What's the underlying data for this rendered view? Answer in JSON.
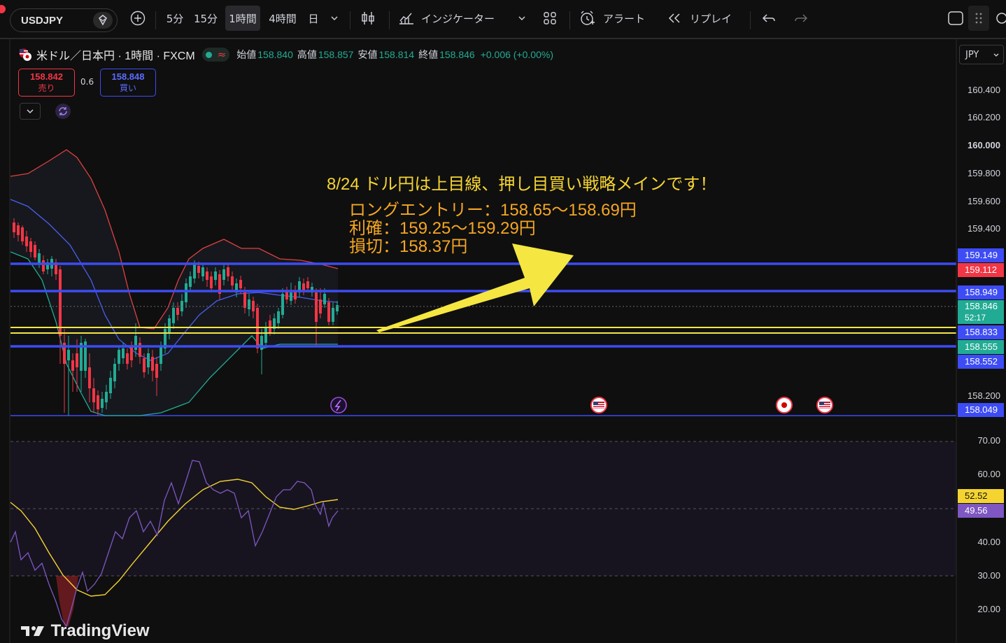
{
  "toolbar": {
    "symbol": "USDJPY",
    "intervals": [
      "5分",
      "15分",
      "1時間",
      "4時間",
      "日"
    ],
    "indicators_label": "インジケーター",
    "alert_label": "アラート",
    "replay_label": "リプレイ"
  },
  "legend": {
    "title": "米ドル／日本円 · 1時間 · FXCM",
    "open_label": "始値",
    "open": "158.840",
    "high_label": "高値",
    "high": "158.857",
    "low_label": "安値",
    "low": "158.814",
    "close_label": "終値",
    "close": "158.846",
    "change": "+0.006 (+0.00%)"
  },
  "trade": {
    "sell_price": "158.842",
    "sell_label": "売り",
    "spread": "0.6",
    "buy_price": "158.848",
    "buy_label": "買い"
  },
  "currency": "JPY",
  "price_axis": [
    "160.400",
    "160.200",
    "160.000",
    "159.800",
    "159.600",
    "159.400",
    "158.200"
  ],
  "price_tags": [
    {
      "value": "159.149",
      "color": "#3d4cf5"
    },
    {
      "value": "159.112",
      "color": "#f23645"
    },
    {
      "value": "158.949",
      "color": "#3d4cf5"
    },
    {
      "value": "158.846",
      "color": "#22ab94",
      "countdown": "52:17"
    },
    {
      "value": "158.833",
      "color": "#3d4cf5"
    },
    {
      "value": "158.555",
      "color": "#22ab94"
    },
    {
      "value": "158.552",
      "color": "#3d4cf5"
    },
    {
      "value": "158.049",
      "color": "#3d4cf5"
    }
  ],
  "rsi_axis": [
    "70.00",
    "60.00",
    "40.00",
    "30.00",
    "20.00"
  ],
  "rsi_tags": [
    {
      "value": "52.52",
      "color": "#f5d432"
    },
    {
      "value": "49.56",
      "color": "#7e57c2"
    }
  ],
  "annotation": {
    "headline": "8/24 ドル円は上目線、押し目買い戦略メインです！",
    "entry": "ロングエントリー：158.65〜158.69円",
    "take_profit": "利確：159.25〜159.29円",
    "stop_loss": "損切：158.37円"
  },
  "brand": "TradingView",
  "colors": {
    "background": "#0f0f0f",
    "up": "#22ab94",
    "down": "#f23645",
    "level_line": "#3d4cf5",
    "yellow_line": "#f5e642",
    "annotation_headline": "#f5d432",
    "annotation_body": "#f5a623",
    "arrow": "#f5e642",
    "rsi": "#7e57c2",
    "rsi_ma": "#f5d432"
  }
}
